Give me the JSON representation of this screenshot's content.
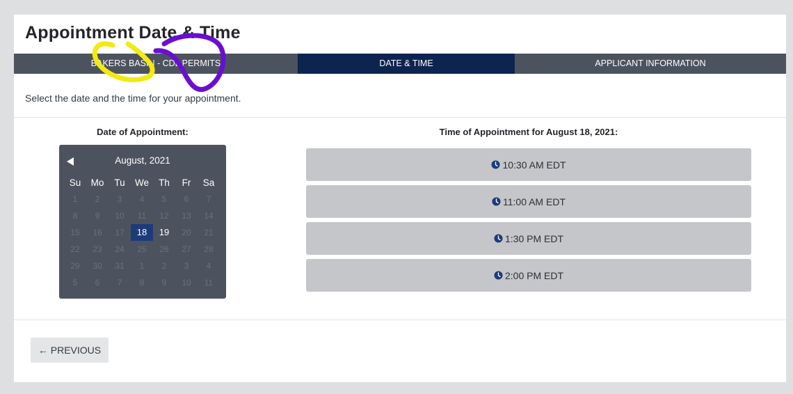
{
  "page": {
    "title": "Appointment Date & Time",
    "instructions": "Select the date and the time for your appointment."
  },
  "steps": [
    {
      "label": "BAKERS BASIN - CDL PERMITS"
    },
    {
      "label": "DATE & TIME"
    },
    {
      "label": "APPLICANT INFORMATION"
    }
  ],
  "date_section": {
    "label": "Date of Appointment:",
    "month": "August, 2021",
    "weekdays": [
      "Su",
      "Mo",
      "Tu",
      "We",
      "Th",
      "Fr",
      "Sa"
    ],
    "days": [
      "1",
      "2",
      "3",
      "4",
      "5",
      "6",
      "7",
      "8",
      "9",
      "10",
      "11",
      "12",
      "13",
      "14",
      "15",
      "16",
      "17",
      "18",
      "19",
      "20",
      "21",
      "22",
      "23",
      "24",
      "25",
      "26",
      "27",
      "28",
      "29",
      "30",
      "31",
      "1",
      "2",
      "3",
      "4",
      "5",
      "6",
      "7",
      "8",
      "9",
      "10",
      "11"
    ],
    "selected_day": "18",
    "available_days": [
      "19"
    ]
  },
  "time_section": {
    "label": "Time of Appointment for August 18, 2021:",
    "slots": [
      {
        "label": "10:30 AM EDT",
        "icon": "clock-icon"
      },
      {
        "label": "11:00 AM EDT",
        "icon": "clock-icon"
      },
      {
        "label": "1:30 PM EDT",
        "icon": "clock-icon"
      },
      {
        "label": "2:00 PM EDT",
        "icon": "clock-icon"
      }
    ]
  },
  "nav": {
    "previous_label": "← PREVIOUS"
  },
  "colors": {
    "step_active": "#0d2451",
    "step_inactive": "#4d535e",
    "calendar_bg": "#4d535e",
    "selected_day": "#1c3b7a",
    "slot_bg": "#c5c6c9",
    "clock_icon": "#1c3b7a",
    "highlight_yellow": "#f2ea10",
    "highlight_purple": "#6a0fd0"
  }
}
